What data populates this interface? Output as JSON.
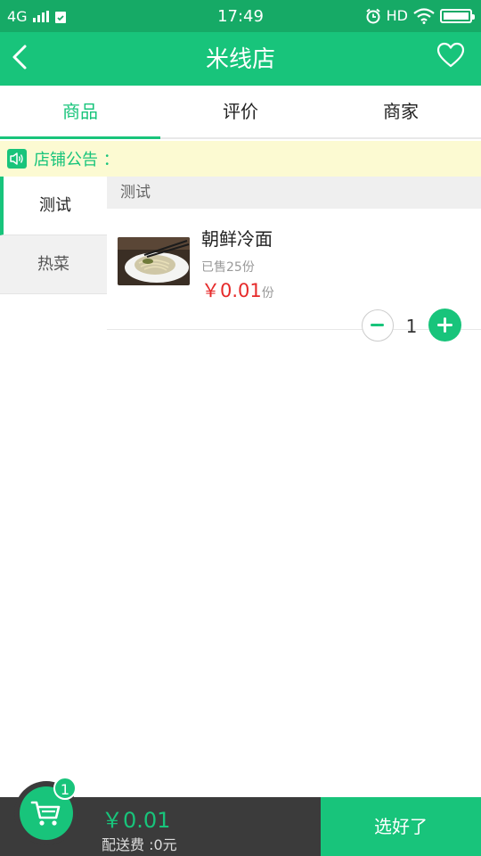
{
  "status_bar": {
    "network": "4G",
    "time": "17:49",
    "hd": "HD"
  },
  "header": {
    "title": "米线店",
    "back_icon": "chevron-left-icon",
    "fav_icon": "heart-outline-icon"
  },
  "tabs": [
    {
      "label": "商品",
      "active": true
    },
    {
      "label": "评价",
      "active": false
    },
    {
      "label": "商家",
      "active": false
    }
  ],
  "notice": {
    "label": "店铺公告 ：",
    "icon": "speaker-icon"
  },
  "categories": [
    {
      "label": "测试",
      "active": true
    },
    {
      "label": "热菜",
      "active": false
    }
  ],
  "section": {
    "title": "测试",
    "items": [
      {
        "name": "朝鲜冷面",
        "sold": "已售25份",
        "price": "￥0.01",
        "unit": "份",
        "quantity": "1"
      }
    ]
  },
  "cart": {
    "badge_count": "1",
    "total": "￥0.01",
    "delivery_fee": "配送费 :0元",
    "confirm_label": "选好了",
    "icon": "cart-icon"
  },
  "colors": {
    "primary": "#18c47b",
    "status_bar": "#16aa66",
    "price": "#e62a2a",
    "notice_bg": "#fcfad2",
    "bottom_bar": "#3b3b3b"
  }
}
